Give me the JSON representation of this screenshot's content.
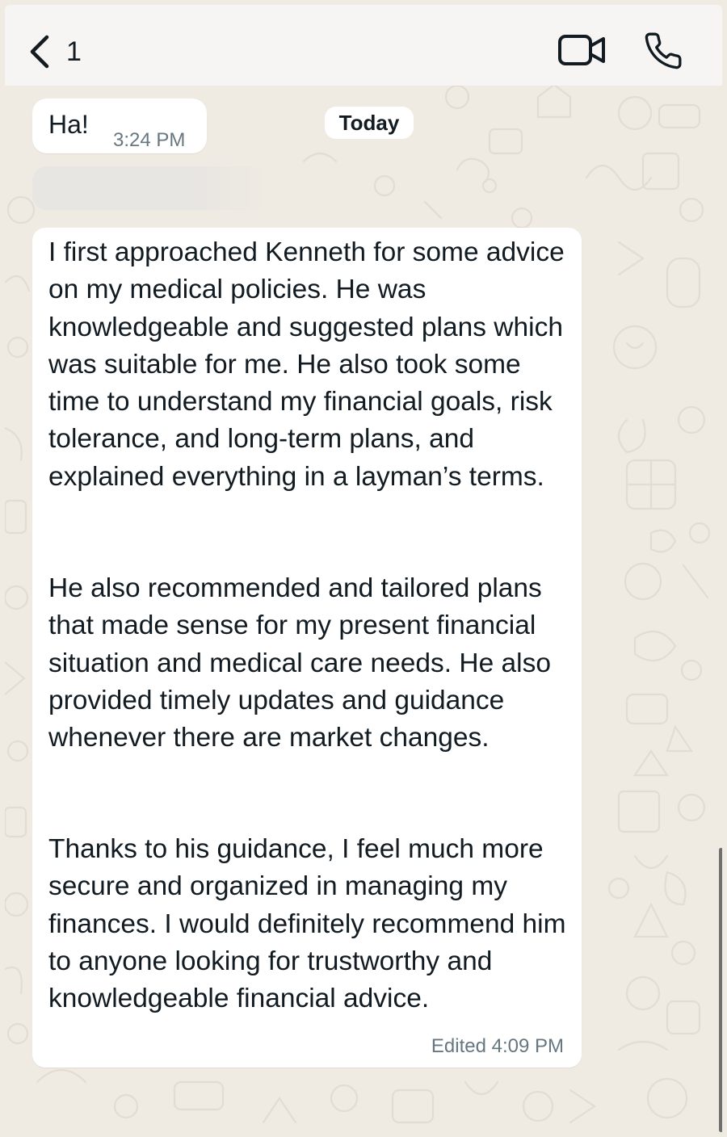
{
  "header": {
    "back_count": "1",
    "icons": [
      "chevron-left-icon",
      "video-call-icon",
      "phone-call-icon"
    ]
  },
  "chat": {
    "date_label": "Today",
    "messages": [
      {
        "text": "Ha!",
        "time": "3:24 PM"
      },
      {
        "paragraphs": [
          "I first approached Kenneth for some advice on my medical policies. He was knowledgeable and suggested plans which was suitable for me. He also took some time to understand my financial goals, risk tolerance, and long-term plans, and explained everything in a layman’s terms.",
          "He also recommended and tailored plans that made sense for my present financial situation and medical care needs. He also provided timely updates and guidance whenever there are market changes.",
          "Thanks to his guidance, I feel much more secure and organized in managing my finances. I would definitely recommend him to anyone looking for trustworthy and knowledgeable financial advice."
        ],
        "status": "Edited 4:09 PM"
      }
    ]
  },
  "colors": {
    "chat_background": "#efeae2",
    "bubble": "#ffffff",
    "header": "#f6f5f3",
    "secondary_text": "#667781"
  }
}
